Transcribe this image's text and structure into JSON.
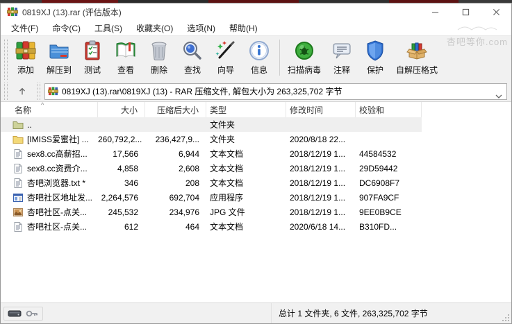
{
  "window": {
    "title": "0819XJ (13).rar (评估版本)"
  },
  "watermark": {
    "text": "杏吧等你.com"
  },
  "menu": {
    "items": [
      {
        "label": "文件(F)"
      },
      {
        "label": "命令(C)"
      },
      {
        "label": "工具(S)"
      },
      {
        "label": "收藏夹(O)"
      },
      {
        "label": "选项(N)"
      },
      {
        "label": "帮助(H)"
      }
    ]
  },
  "toolbar": {
    "buttons": [
      {
        "label": "添加",
        "icon": "add-books-icon"
      },
      {
        "label": "解压到",
        "icon": "extract-folder-icon"
      },
      {
        "label": "测试",
        "icon": "test-clipboard-icon"
      },
      {
        "label": "查看",
        "icon": "view-book-icon"
      },
      {
        "label": "删除",
        "icon": "delete-trash-icon"
      },
      {
        "label": "查找",
        "icon": "find-magnifier-icon"
      },
      {
        "label": "向导",
        "icon": "wizard-wand-icon"
      },
      {
        "label": "信息",
        "icon": "info-icon",
        "separator_after": true
      },
      {
        "label": "扫描病毒",
        "icon": "scan-virus-icon"
      },
      {
        "label": "注释",
        "icon": "comment-icon"
      },
      {
        "label": "保护",
        "icon": "protect-shield-icon"
      },
      {
        "label": "自解压格式",
        "icon": "sfx-box-icon"
      }
    ]
  },
  "addressbar": {
    "path": "0819XJ (13).rar\\0819XJ (13) - RAR 压缩文件, 解包大小为 263,325,702 字节"
  },
  "filelist": {
    "columns": [
      {
        "label": "名称"
      },
      {
        "label": "大小"
      },
      {
        "label": "压缩后大小"
      },
      {
        "label": "类型"
      },
      {
        "label": "修改时间"
      },
      {
        "label": "校验和"
      }
    ],
    "sort_column": "名称",
    "sort_indicator": "^",
    "rows": [
      {
        "name": "..",
        "size": "",
        "packed": "",
        "type": "文件夹",
        "modified": "",
        "checksum": "",
        "icon": "folder-up-icon",
        "selected": true
      },
      {
        "name": "[IMISS爱蜜社] ...",
        "size": "260,792,2...",
        "packed": "236,427,9...",
        "type": "文件夹",
        "modified": "2020/8/18 22...",
        "checksum": "",
        "icon": "folder-icon",
        "selected": false
      },
      {
        "name": "sex8.cc高薪招...",
        "size": "17,566",
        "packed": "6,944",
        "type": "文本文档",
        "modified": "2018/12/19 1...",
        "checksum": "44584532",
        "icon": "text-file-icon",
        "selected": false
      },
      {
        "name": "sex8.cc资费介...",
        "size": "4,858",
        "packed": "2,608",
        "type": "文本文档",
        "modified": "2018/12/19 1...",
        "checksum": "29D59442",
        "icon": "text-file-icon",
        "selected": false
      },
      {
        "name": "杏吧浏览器.txt *",
        "size": "346",
        "packed": "208",
        "type": "文本文档",
        "modified": "2018/12/19 1...",
        "checksum": "DC6908F7",
        "icon": "text-file-icon",
        "selected": false
      },
      {
        "name": "杏吧社区地址发...",
        "size": "2,264,576",
        "packed": "692,704",
        "type": "应用程序",
        "modified": "2018/12/19 1...",
        "checksum": "907FA9CF",
        "icon": "exe-icon",
        "selected": false
      },
      {
        "name": "杏吧社区-点关...",
        "size": "245,532",
        "packed": "234,976",
        "type": "JPG 文件",
        "modified": "2018/12/19 1...",
        "checksum": "9EE0B9CE",
        "icon": "jpg-icon",
        "selected": false
      },
      {
        "name": "杏吧社区-点关...",
        "size": "612",
        "packed": "464",
        "type": "文本文档",
        "modified": "2020/6/18 14...",
        "checksum": "B310FD...",
        "icon": "text-file-icon",
        "selected": false
      }
    ]
  },
  "statusbar": {
    "total": "总计 1 文件夹, 6 文件, 263,325,702 字节"
  }
}
